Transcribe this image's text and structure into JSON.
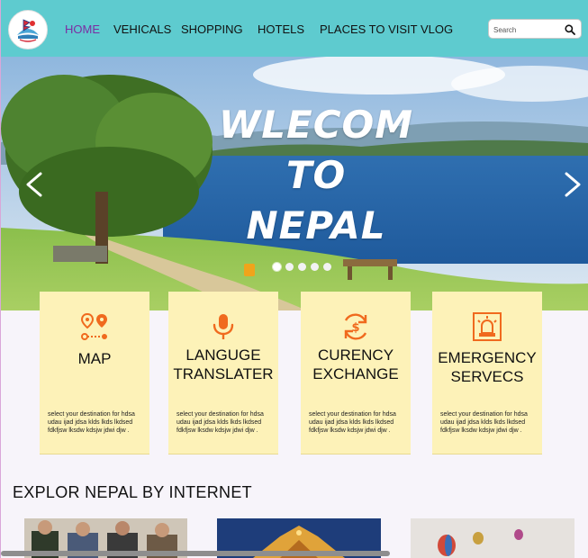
{
  "nav": {
    "items": [
      {
        "label": "HOME",
        "active": true
      },
      {
        "label": "VEHICALS",
        "active": false
      },
      {
        "label": "SHOPPING",
        "active": false
      },
      {
        "label": "HOTELS",
        "active": false
      },
      {
        "label": "PLACES TO VISIT",
        "active": false
      },
      {
        "label": "VLOG",
        "active": false
      }
    ],
    "search_placeholder": "Search",
    "active_color": "#7b2ea3",
    "background_color": "#5ecbcf"
  },
  "hero": {
    "title_lines": [
      "WLECOM",
      "TO",
      "NEPAL"
    ],
    "prev_glyph": "<",
    "next_glyph": ">",
    "slide_count": 5,
    "active_slide": 0
  },
  "cards": [
    {
      "icon": "map-route-icon",
      "title_lines": [
        "MAP"
      ],
      "desc": "select your destination for hdsa udau ijad jdsa klds lkds lkdsed fdkfjsw lksdw kdsjw jdwi djw ."
    },
    {
      "icon": "microphone-icon",
      "title_lines": [
        "LANGUGE",
        "TRANSLATER"
      ],
      "desc": "select your destination for hdsa udau ijad jdsa klds lkds lkdsed fdkfjsw lksdw kdsjw jdwi djw ."
    },
    {
      "icon": "currency-exchange-icon",
      "title_lines": [
        "CURENCY",
        "EXCHANGE"
      ],
      "desc": "select your destination for hdsa udau ijad jdsa klds lkds lkdsed fdkfjsw lksdw kdsjw jdwi djw ."
    },
    {
      "icon": "emergency-siren-icon",
      "title_lines": [
        "EMERGENCY",
        "SERVECS"
      ],
      "desc": "select your destination for hdsa udau ijad jdsa klds lkds lkdsed fdkfjsw lksdw kdsjw jdwi djw ."
    }
  ],
  "section": {
    "title": "EXPLOR  NEPAL BY INTERNET"
  },
  "colors": {
    "card_bg": "#fdf2b8",
    "icon_accent": "#f06a1e"
  }
}
